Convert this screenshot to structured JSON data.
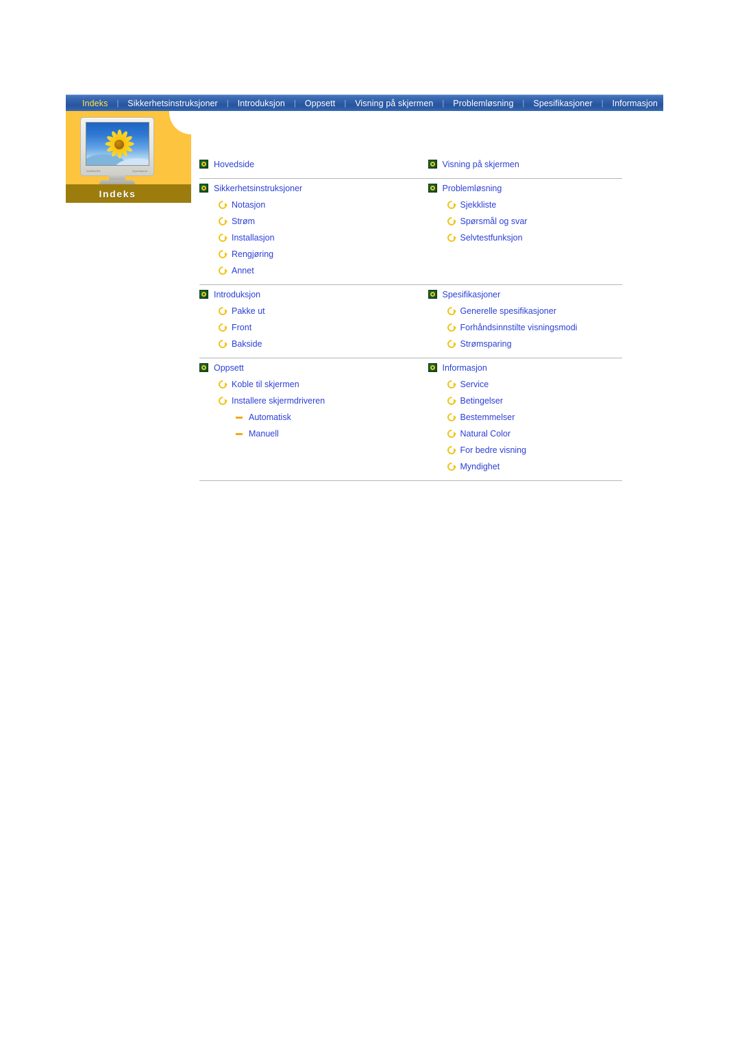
{
  "nav": {
    "separator": "|",
    "items": [
      {
        "label": "Indeks",
        "active": true
      },
      {
        "label": "Sikkerhetsinstruksjoner",
        "active": false
      },
      {
        "label": "Introduksjon",
        "active": false
      },
      {
        "label": "Oppsett",
        "active": false
      },
      {
        "label": "Visning på skjermen",
        "active": false
      },
      {
        "label": "Problemløsning",
        "active": false
      },
      {
        "label": "Spesifikasjoner",
        "active": false
      },
      {
        "label": "Informasjon",
        "active": false
      }
    ],
    "active_color": "#ffe44d",
    "text_color": "#ffffff",
    "background_color": "#2f5da8"
  },
  "banner": {
    "caption": "Indeks",
    "panel_color": "#fdc43f",
    "caption_band_color": "#9c7c0d",
    "caption_text_color": "#ffffff",
    "monitor_icon": "crt-monitor-sunflower"
  },
  "index": {
    "link_color": "#2b3fd4",
    "divider_color": "#b5b5b5",
    "groups": [
      {
        "left": {
          "title": "Hovedside",
          "children": []
        },
        "right": {
          "title": "Visning på skjermen",
          "children": []
        }
      },
      {
        "left": {
          "title": "Sikkerhetsinstruksjoner",
          "children": [
            {
              "label": "Notasjon"
            },
            {
              "label": "Strøm"
            },
            {
              "label": "Installasjon"
            },
            {
              "label": "Rengjøring"
            },
            {
              "label": "Annet"
            }
          ]
        },
        "right": {
          "title": "Problemløsning",
          "children": [
            {
              "label": "Sjekkliste"
            },
            {
              "label": "Spørsmål og svar"
            },
            {
              "label": "Selvtestfunksjon"
            }
          ]
        }
      },
      {
        "left": {
          "title": "Introduksjon",
          "children": [
            {
              "label": "Pakke ut"
            },
            {
              "label": "Front"
            },
            {
              "label": "Bakside"
            }
          ]
        },
        "right": {
          "title": "Spesifikasjoner",
          "children": [
            {
              "label": "Generelle spesifikasjoner"
            },
            {
              "label": "Forhåndsinnstilte visningsmodi"
            },
            {
              "label": "Strømsparing"
            }
          ]
        }
      },
      {
        "left": {
          "title": "Oppsett",
          "children": [
            {
              "label": "Koble til skjermen"
            },
            {
              "label": "Installere skjermdriveren"
            },
            {
              "label": "Automatisk",
              "level": 3
            },
            {
              "label": "Manuell",
              "level": 3
            }
          ]
        },
        "right": {
          "title": "Informasjon",
          "children": [
            {
              "label": "Service"
            },
            {
              "label": "Betingelser"
            },
            {
              "label": "Bestemmelser"
            },
            {
              "label": "Natural Color"
            },
            {
              "label": "For bedre visning"
            },
            {
              "label": "Myndighet"
            }
          ]
        }
      }
    ]
  }
}
